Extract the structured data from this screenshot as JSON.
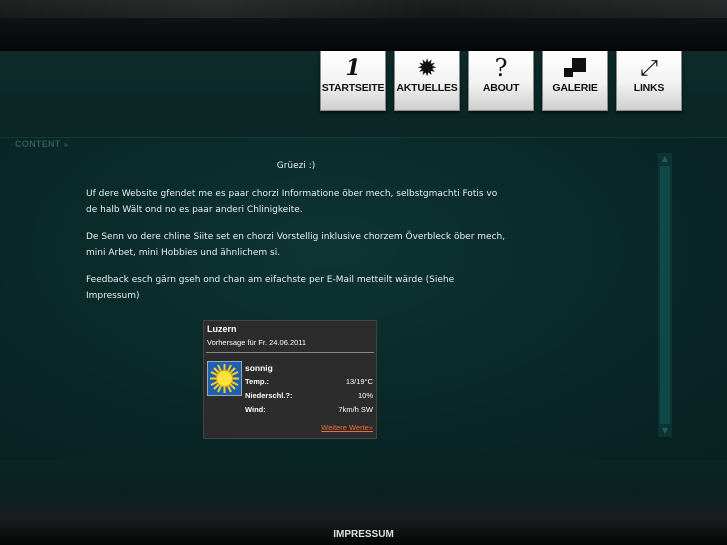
{
  "nav": {
    "items": [
      {
        "label": "STARTSEITE",
        "icon": "one-glyph-icon",
        "glyph": "1"
      },
      {
        "label": "AKTUELLES",
        "icon": "star-burst-icon",
        "glyph": "✹"
      },
      {
        "label": "ABOUT",
        "icon": "question-mark-icon",
        "glyph": "?"
      },
      {
        "label": "GALERIE",
        "icon": "gallery-squares-icon",
        "glyph": ""
      },
      {
        "label": "LINKS",
        "icon": "diagonal-arrows-icon",
        "glyph": "⤢"
      }
    ]
  },
  "content": {
    "label": "CONTENT",
    "chevron": "»",
    "greeting": "Grüezi :)",
    "paragraphs": [
      "Uf dere Website gfendet me es paar chorzi Informatione öber mech, selbstgmachti Fotis vo de halb Wält ond no es paar anderi Chlinigkeite.",
      "De Senn vo dere chline Siite set en chorzi Vorstellig inklusive chorzem Överbleck öber mech, mini Arbet, mini Hobbies und ähnlichem si.",
      "Feedback esch gärn gseh ond chan am eifachste per E-Mail metteilt wärde (Siehe Impressum)"
    ]
  },
  "weather": {
    "city": "Luzern",
    "forecast": "Vorhersage für Fr. 24.06.2011",
    "condition": "sonnig",
    "icon": "sun-icon",
    "rows": [
      {
        "label": "Temp.:",
        "value": "13/19°C"
      },
      {
        "label": "Niederschl.?:",
        "value": "10%"
      },
      {
        "label": "Wind:",
        "value": "7km/h SW"
      }
    ],
    "more_link": "Weitere Werte»"
  },
  "footer": {
    "impressum": "IMPRESSUM"
  },
  "colors": {
    "background": "#07201f",
    "link": "#e8703a",
    "nav_button": "#f2f2f2"
  }
}
